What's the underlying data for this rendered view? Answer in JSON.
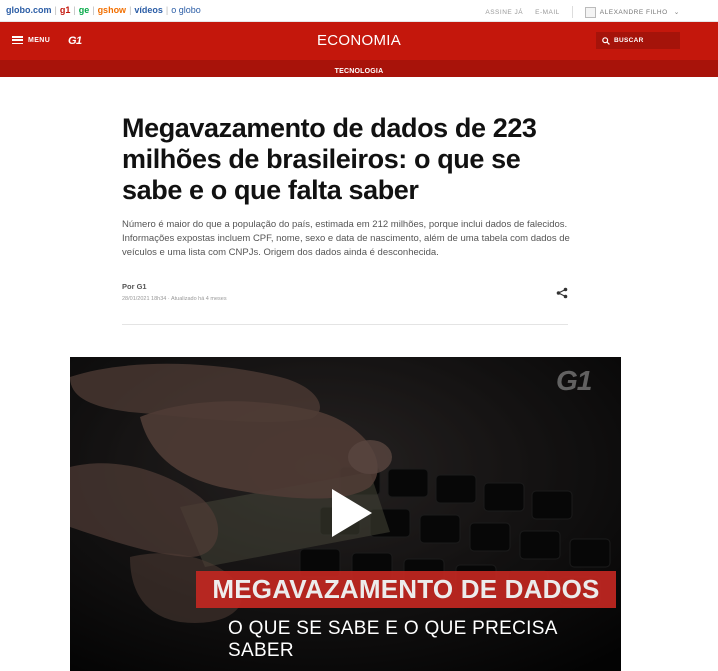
{
  "globo_bar": {
    "links": [
      {
        "label": "globo.com"
      },
      {
        "label": "g1"
      },
      {
        "label": "ge"
      },
      {
        "label": "gshow"
      },
      {
        "label": "vídeos"
      },
      {
        "label": "o globo"
      }
    ],
    "subscribe": "ASSINE JÁ",
    "email": "E-MAIL",
    "user_name": "ALEXANDRE FILHO"
  },
  "header": {
    "menu_label": "MENU",
    "logo_text": "G1",
    "section_title": "ECONOMIA",
    "search_label": "BUSCAR",
    "sub_section": "TECNOLOGIA",
    "brand_color": "#c4170c"
  },
  "article": {
    "title": "Megavazamento de dados de 223 milhões de brasileiros: o que se sabe e o que falta saber",
    "summary": "Número é maior do que a população do país, estimada em 212 milhões, porque inclui dados de falecidos. Informações expostas incluem CPF, nome, sexo e data de nascimento, além de uma tabela com dados de veículos e uma lista com CNPJs. Origem dos dados ainda é desconhecida.",
    "author": "Por G1",
    "date": "28/01/2021 18h34",
    "updated": "Atualizado há 4 meses",
    "share_icon": "share-icon"
  },
  "video": {
    "watermark": "G1",
    "headline": "MEGAVAZAMENTO DE DADOS",
    "subtitle": "O QUE SE SABE E O QUE PRECISA SABER",
    "play_icon": "play-icon"
  }
}
